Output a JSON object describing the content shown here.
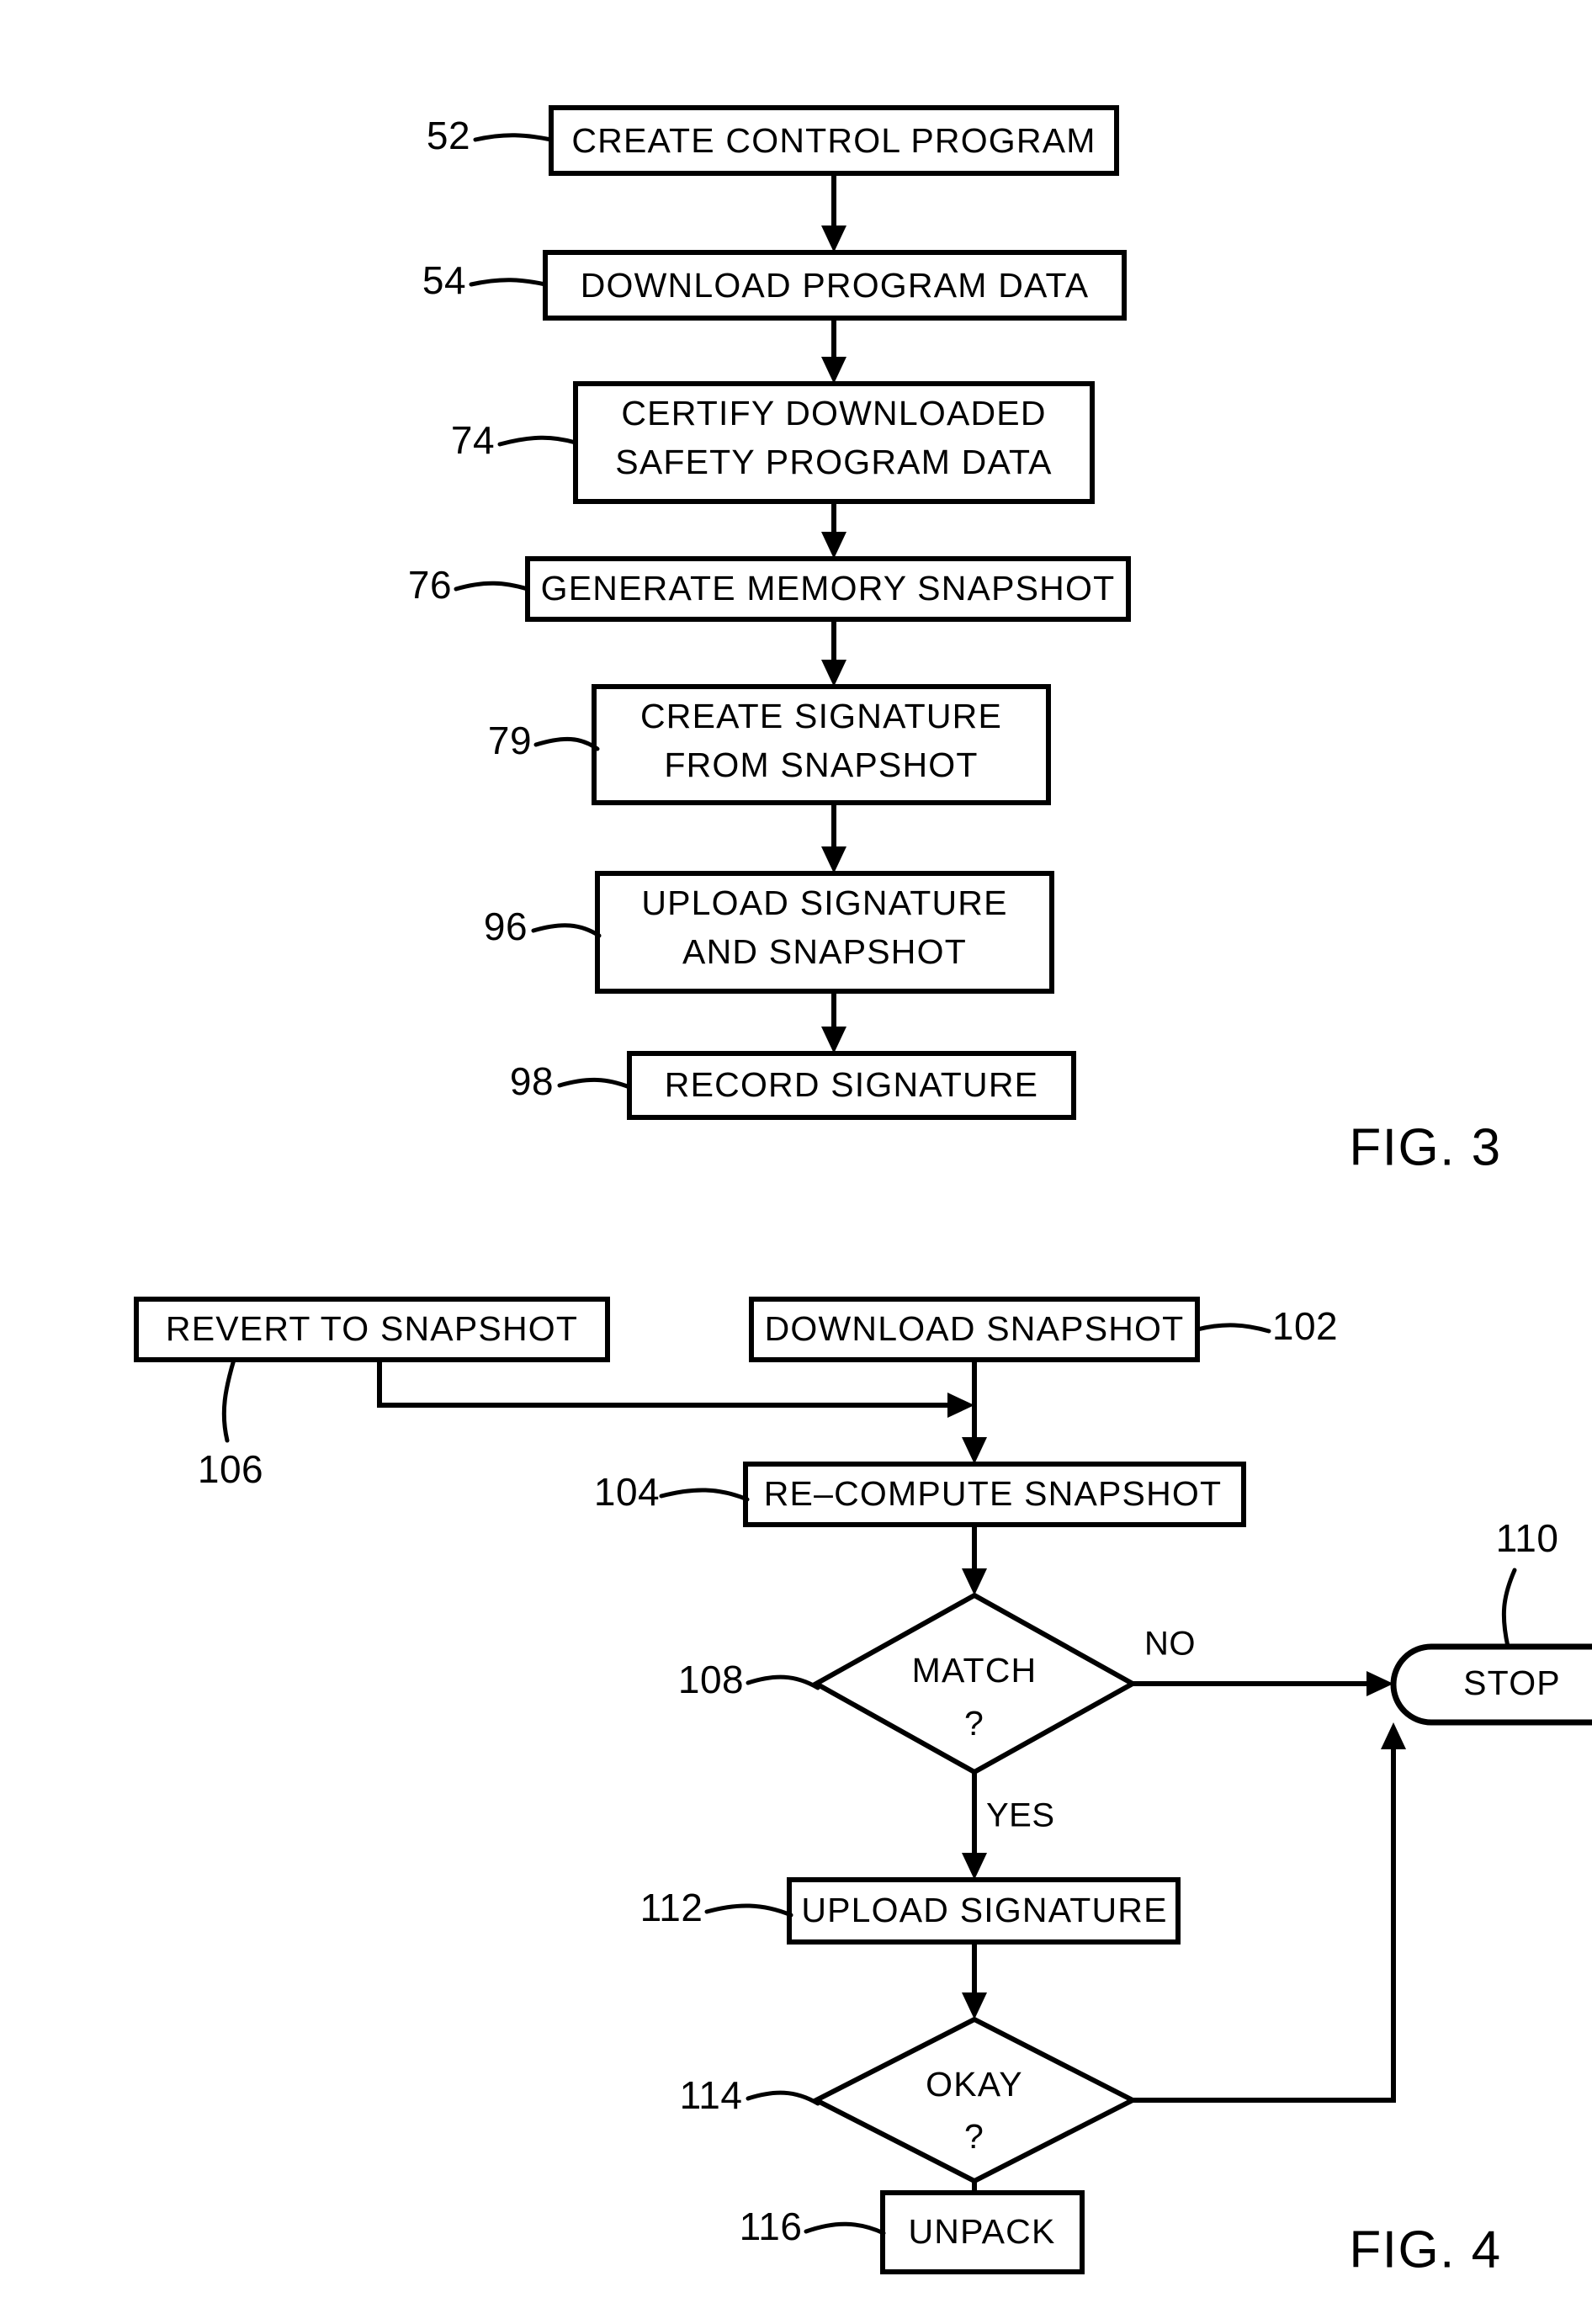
{
  "document": {
    "type": "patent-drawing-sheet",
    "background_color": "#ffffff",
    "ink_color": "#000000"
  },
  "figures": [
    {
      "id": "fig3",
      "caption": "FIG. 3",
      "nodes": [
        {
          "ref": "52",
          "shape": "process",
          "lines": [
            "CREATE CONTROL PROGRAM"
          ]
        },
        {
          "ref": "54",
          "shape": "process",
          "lines": [
            "DOWNLOAD  PROGRAM  DATA"
          ]
        },
        {
          "ref": "74",
          "shape": "process",
          "lines": [
            "CERTIFY  DOWNLOADED",
            "SAFETY  PROGRAM  DATA"
          ]
        },
        {
          "ref": "76",
          "shape": "process",
          "lines": [
            "GENERATE  MEMORY  SNAPSHOT"
          ]
        },
        {
          "ref": "79",
          "shape": "process",
          "lines": [
            "CREATE  SIGNATURE",
            "FROM  SNAPSHOT"
          ]
        },
        {
          "ref": "96",
          "shape": "process",
          "lines": [
            "UPLOAD  SIGNATURE",
            "AND  SNAPSHOT"
          ]
        },
        {
          "ref": "98",
          "shape": "process",
          "lines": [
            "RECORD  SIGNATURE"
          ]
        }
      ],
      "edges": []
    },
    {
      "id": "fig4",
      "caption": "FIG. 4",
      "nodes": [
        {
          "ref": "106",
          "shape": "process",
          "lines": [
            "REVERT  TO  SNAPSHOT"
          ]
        },
        {
          "ref": "102",
          "shape": "process",
          "lines": [
            "DOWNLOAD  SNAPSHOT"
          ]
        },
        {
          "ref": "104",
          "shape": "process",
          "lines": [
            "RE–COMPUTE  SNAPSHOT"
          ]
        },
        {
          "ref": "108",
          "shape": "decision",
          "lines": [
            "MATCH",
            "?"
          ]
        },
        {
          "ref": "110",
          "shape": "terminator",
          "lines": [
            "STOP"
          ]
        },
        {
          "ref": "112",
          "shape": "process",
          "lines": [
            "UPLOAD  SIGNATURE"
          ]
        },
        {
          "ref": "114",
          "shape": "decision",
          "lines": [
            "OKAY",
            "?"
          ]
        },
        {
          "ref": "116",
          "shape": "process",
          "lines": [
            "UNPACK"
          ]
        }
      ],
      "edges": [
        {
          "from": "108",
          "to": "110",
          "label": "NO"
        },
        {
          "from": "108",
          "to": "112",
          "label": "YES"
        },
        {
          "from": "114",
          "to": "110",
          "label": ""
        },
        {
          "from": "114",
          "to": "116",
          "label": ""
        }
      ]
    }
  ],
  "fig3": {
    "caption": "FIG. 3",
    "box52": {
      "ref": "52",
      "line1": "CREATE CONTROL PROGRAM"
    },
    "box54": {
      "ref": "54",
      "line1": "DOWNLOAD  PROGRAM  DATA"
    },
    "box74": {
      "ref": "74",
      "line1": "CERTIFY  DOWNLOADED",
      "line2": "SAFETY  PROGRAM  DATA"
    },
    "box76": {
      "ref": "76",
      "line1": "GENERATE  MEMORY  SNAPSHOT"
    },
    "box79": {
      "ref": "79",
      "line1": "CREATE  SIGNATURE",
      "line2": "FROM  SNAPSHOT"
    },
    "box96": {
      "ref": "96",
      "line1": "UPLOAD  SIGNATURE",
      "line2": "AND  SNAPSHOT"
    },
    "box98": {
      "ref": "98",
      "line1": "RECORD  SIGNATURE"
    }
  },
  "fig4": {
    "caption": "FIG. 4",
    "box106": {
      "ref": "106",
      "line1": "REVERT  TO  SNAPSHOT"
    },
    "box102": {
      "ref": "102",
      "line1": "DOWNLOAD  SNAPSHOT"
    },
    "box104": {
      "ref": "104",
      "line1": "RE–COMPUTE  SNAPSHOT"
    },
    "diamond108": {
      "ref": "108",
      "line1": "MATCH",
      "line2": "?"
    },
    "stop110": {
      "ref": "110",
      "line1": "STOP"
    },
    "box112": {
      "ref": "112",
      "line1": "UPLOAD  SIGNATURE"
    },
    "diamond114": {
      "ref": "114",
      "line1": "OKAY",
      "line2": "?"
    },
    "box116": {
      "ref": "116",
      "line1": "UNPACK"
    },
    "labels": {
      "no": "NO",
      "yes": "YES"
    }
  }
}
